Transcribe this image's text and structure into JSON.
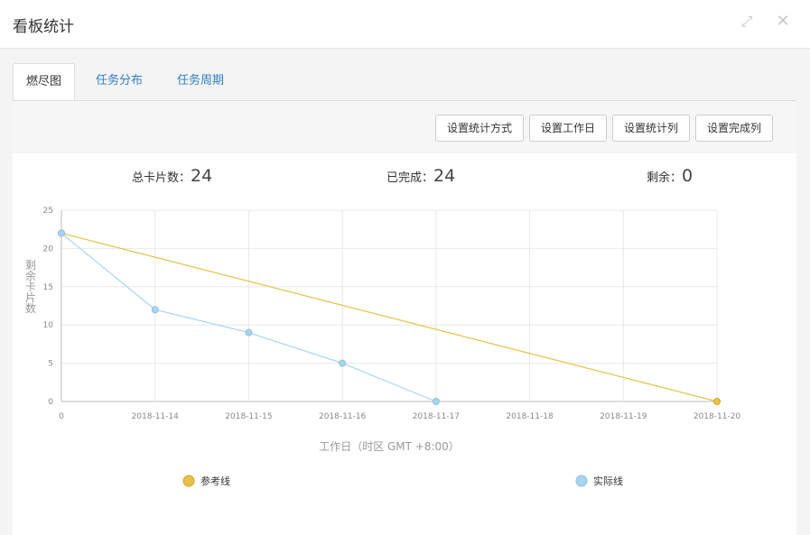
{
  "dialog": {
    "title": "看板统计",
    "expand_icon": "expand-icon",
    "close_icon": "close-icon"
  },
  "tabs": [
    {
      "label": "燃尽图",
      "active": true
    },
    {
      "label": "任务分布",
      "active": false
    },
    {
      "label": "任务周期",
      "active": false
    }
  ],
  "toolbar": {
    "buttons": [
      "设置统计方式",
      "设置工作日",
      "设置统计列",
      "设置完成列"
    ]
  },
  "stats": {
    "total_label": "总卡片数：",
    "total_value": "24",
    "done_label": "已完成：",
    "done_value": "24",
    "remaining_label": "剩余：",
    "remaining_value": "0"
  },
  "chart_data": {
    "type": "line",
    "categories": [
      "0",
      "2018-11-14",
      "2018-11-15",
      "2018-11-16",
      "2018-11-17",
      "2018-11-18",
      "2018-11-19",
      "2018-11-20"
    ],
    "ylim": [
      0,
      25
    ],
    "yticks": [
      0,
      5,
      10,
      15,
      20,
      25
    ],
    "ylabel": "剩余卡片数",
    "xlabel": "工作日（时区 GMT +8:00）",
    "grid": true,
    "legend_position": "bottom",
    "series": [
      {
        "name": "参考线",
        "color": "#e8c04a",
        "values": [
          22,
          null,
          null,
          null,
          null,
          null,
          null,
          0
        ]
      },
      {
        "name": "实际线",
        "color": "#a9d4ee",
        "values": [
          22,
          12,
          9,
          5,
          0,
          null,
          null,
          null
        ]
      }
    ]
  }
}
